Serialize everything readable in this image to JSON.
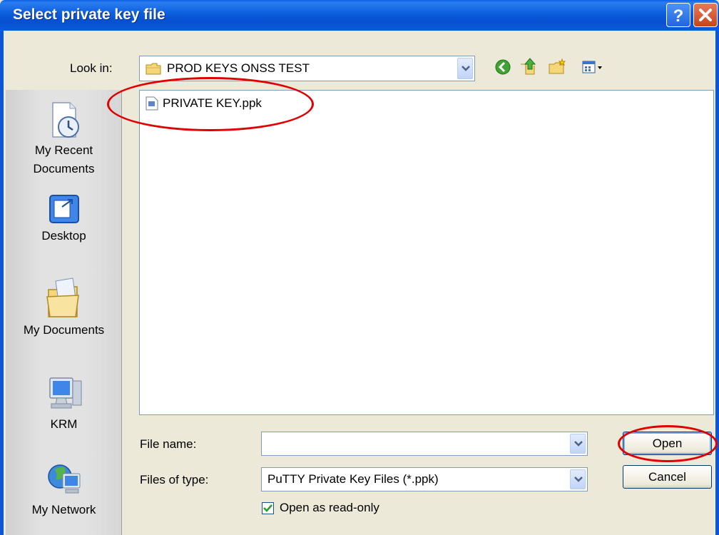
{
  "window": {
    "title": "Select private key file"
  },
  "toolbar": {
    "look_in_label": "Look in:",
    "look_in_value": "PROD KEYS ONSS TEST",
    "icons": [
      "back-icon",
      "up-folder-icon",
      "new-folder-icon",
      "views-menu-icon"
    ]
  },
  "places": [
    {
      "label_line1": "My Recent",
      "label_line2": "Documents",
      "icon": "recent-documents-icon"
    },
    {
      "label_line1": "Desktop",
      "icon": "desktop-icon"
    },
    {
      "label_line1": "My Documents",
      "icon": "my-documents-icon"
    },
    {
      "label_line1": "KRM",
      "icon": "computer-icon"
    },
    {
      "label_line1": "My Network",
      "icon": "network-icon"
    }
  ],
  "files": [
    {
      "name": "PRIVATE KEY.ppk",
      "icon": "ppk-file-icon"
    }
  ],
  "form": {
    "file_name_label": "File name:",
    "file_name_value": "",
    "file_type_label": "Files of type:",
    "file_type_value": "PuTTY Private Key Files (*.ppk)",
    "readonly_label": "Open as read-only",
    "readonly_checked": true
  },
  "buttons": {
    "open": "Open",
    "cancel": "Cancel"
  },
  "colors": {
    "titlebar": "#0a5fe6",
    "dialog_bg": "#ece9d8",
    "annotation": "#e00000"
  }
}
